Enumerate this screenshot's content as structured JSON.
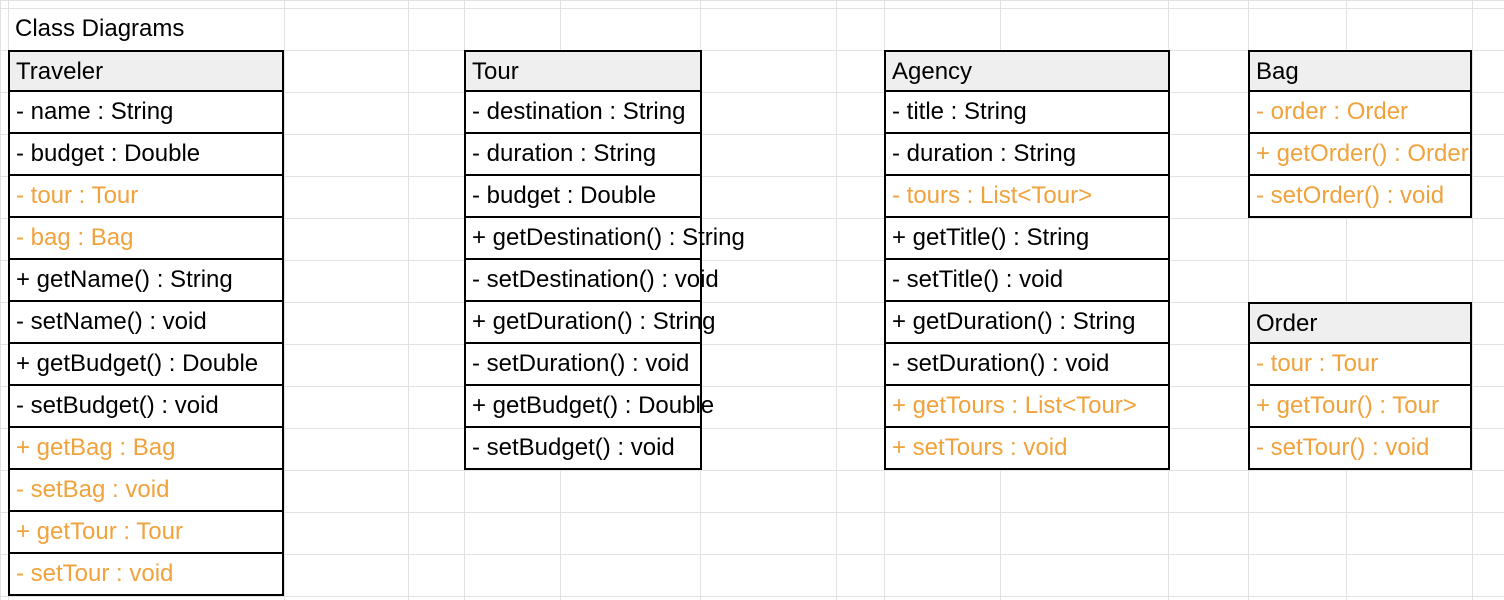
{
  "sheet_title": "Class Diagrams",
  "colors": {
    "highlight": "#f0a23c",
    "header_bg": "#efefef",
    "grid": "#e2e2e2"
  },
  "classes": {
    "traveler": {
      "name": "Traveler",
      "rows": [
        {
          "text": "- name : String",
          "highlight": false
        },
        {
          "text": "- budget : Double",
          "highlight": false
        },
        {
          "text": "- tour : Tour",
          "highlight": true
        },
        {
          "text": "- bag : Bag",
          "highlight": true
        },
        {
          "text": "+ getName() : String",
          "highlight": false
        },
        {
          "text": "- setName() : void",
          "highlight": false
        },
        {
          "text": "+ getBudget() : Double",
          "highlight": false
        },
        {
          "text": "- setBudget() : void",
          "highlight": false
        },
        {
          "text": "+ getBag : Bag",
          "highlight": true
        },
        {
          "text": "- setBag : void",
          "highlight": true
        },
        {
          "text": "+ getTour : Tour",
          "highlight": true
        },
        {
          "text": "- setTour : void",
          "highlight": true
        }
      ]
    },
    "tour": {
      "name": "Tour",
      "rows": [
        {
          "text": "- destination : String",
          "highlight": false
        },
        {
          "text": "- duration : String",
          "highlight": false
        },
        {
          "text": "- budget : Double",
          "highlight": false
        },
        {
          "text": "+ getDestination() : String",
          "highlight": false
        },
        {
          "text": "- setDestination() : void",
          "highlight": false
        },
        {
          "text": "+ getDuration() : String",
          "highlight": false
        },
        {
          "text": "- setDuration() : void",
          "highlight": false
        },
        {
          "text": "+ getBudget() : Double",
          "highlight": false
        },
        {
          "text": "- setBudget() : void",
          "highlight": false
        }
      ]
    },
    "agency": {
      "name": "Agency",
      "rows": [
        {
          "text": "- title : String",
          "highlight": false
        },
        {
          "text": "- duration : String",
          "highlight": false
        },
        {
          "text": "- tours : List<Tour>",
          "highlight": true
        },
        {
          "text": "+ getTitle() : String",
          "highlight": false
        },
        {
          "text": "- setTitle() : void",
          "highlight": false
        },
        {
          "text": "+ getDuration() : String",
          "highlight": false
        },
        {
          "text": "- setDuration() : void",
          "highlight": false
        },
        {
          "text": "+ getTours : List<Tour>",
          "highlight": true
        },
        {
          "text": "+ setTours : void",
          "highlight": true
        }
      ]
    },
    "bag": {
      "name": "Bag",
      "rows": [
        {
          "text": "- order : Order",
          "highlight": true
        },
        {
          "text": "+ getOrder() : Order",
          "highlight": true
        },
        {
          "text": "- setOrder() : void",
          "highlight": true
        }
      ]
    },
    "order": {
      "name": "Order",
      "rows": [
        {
          "text": "- tour : Tour",
          "highlight": true
        },
        {
          "text": "+ getTour() : Tour",
          "highlight": true
        },
        {
          "text": "- setTour() : void",
          "highlight": true
        }
      ]
    }
  }
}
